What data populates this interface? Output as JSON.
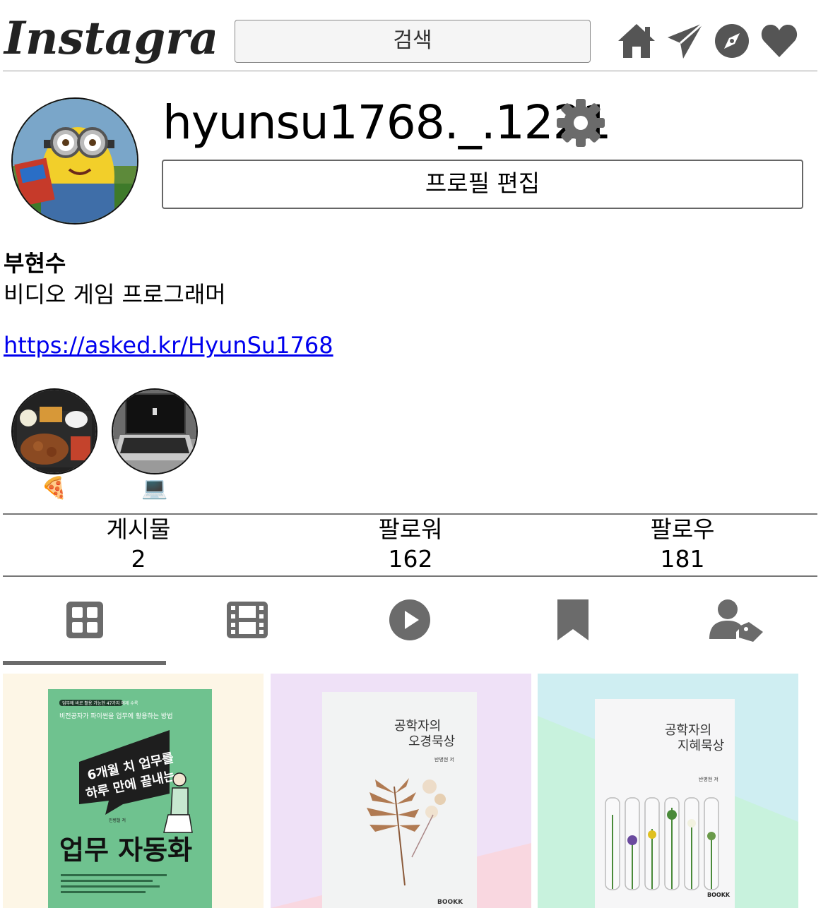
{
  "header": {
    "logo_text": "Instagram",
    "search_placeholder": "검색",
    "nav_icons": [
      "home-icon",
      "direct-message-icon",
      "explore-icon",
      "activity-heart-icon"
    ]
  },
  "profile": {
    "username": "hyunsu1768._.1221",
    "edit_button_label": "프로필 편집",
    "full_name": "부현수",
    "bio": "비디오 게임 프로그래머",
    "link": "https://asked.kr/HyunSu1768"
  },
  "highlights": [
    {
      "label": "🍕",
      "image": "lunchbox-photo"
    },
    {
      "label": "💻",
      "image": "laptop-photo"
    }
  ],
  "stats": [
    {
      "label": "게시물",
      "value": "2"
    },
    {
      "label": "팔로워",
      "value": "162"
    },
    {
      "label": "팔로우",
      "value": "181"
    }
  ],
  "tabs": [
    "grid-icon",
    "film-icon",
    "play-circle-icon",
    "bookmark-icon",
    "user-tag-icon"
  ],
  "active_tab": "grid-icon",
  "posts": [
    {
      "bg": "#fdf6e6",
      "cover": "#6fc28f",
      "top_small": "업무에 바로 활용 가능한 47가지 예제 수록",
      "subtitle": "비전공자가 파이썬을 업무에 활용하는 방법",
      "speech_line1": "6개월 치 업무를",
      "speech_line2": "하루 만에 끝내는",
      "title": "업무 자동화",
      "author": "민병철 저"
    },
    {
      "bg": "#efe1f7",
      "cover": "#f3f3f3",
      "title_line1": "공학자의",
      "title_line2": "오경묵상",
      "author": "반병현 저",
      "publisher": "BOOKK"
    },
    {
      "bg": "#cfeef2",
      "cover": "#f6f6f6",
      "title_line1": "공학자의",
      "title_line2": "지혜묵상",
      "author": "반병현 저",
      "publisher": "BOOKK"
    }
  ],
  "colors": {
    "icon_gray": "#6b6b6b",
    "link_blue": "#0000ee",
    "icon_dark": "#555555"
  }
}
